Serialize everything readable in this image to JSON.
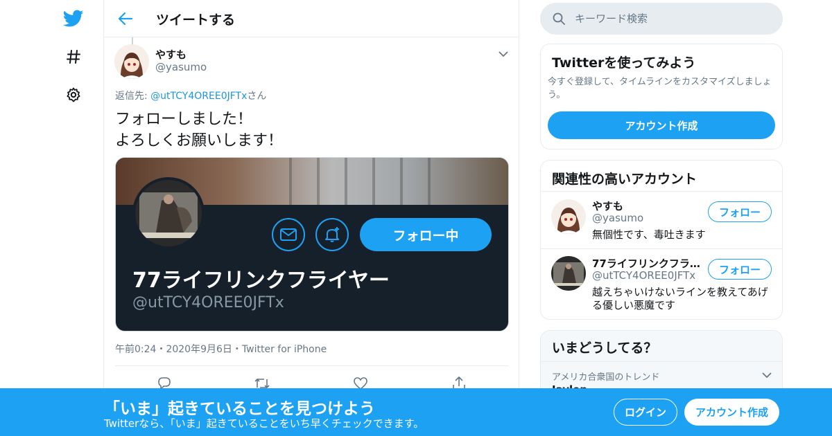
{
  "header": {
    "title": "ツイートする"
  },
  "tweet": {
    "author_name": "やすも",
    "author_handle": "@yasumo",
    "reply_prefix": "返信先: ",
    "reply_to": "@utTCY4OREE0JFTx",
    "reply_suffix": "さん",
    "text": "フォローしました！\nよろしくお願いします！",
    "media": {
      "profile_name": "77ライフリンクフライヤー",
      "profile_handle": "@utTCY4OREE0JFTx",
      "follow_label": "フォロー中"
    },
    "time": "午前0:24",
    "date": "2020年9月6日",
    "source": "Twitter for iPhone",
    "separator": "・"
  },
  "search": {
    "placeholder": "キーワード検索"
  },
  "signup_card": {
    "title": "Twitterを使ってみよう",
    "description": "今すぐ登録して、タイムラインをカスタマイズしましょう。",
    "button": "アカウント作成"
  },
  "related": {
    "title": "関連性の高いアカウント",
    "accounts": [
      {
        "name": "やすも",
        "handle": "@yasumo",
        "bio": "無個性です、毒吐きます",
        "follow": "フォロー"
      },
      {
        "name": "77ライフリンクフライヤー",
        "handle": "@utTCY4OREE0JFTx",
        "bio": "越えちゃいけないラインを教えてあげる優しい悪魔です",
        "follow": "フォロー"
      }
    ]
  },
  "trends": {
    "title": "いまどうしてる？",
    "label": "アメリカ合衆国のトレンド",
    "first": "Jaylen"
  },
  "bottom_bar": {
    "title": "「いま」起きていることを見つけよう",
    "subtitle": "Twitterなら、「いま」起きていることをいち早くチェックできます。",
    "login": "ログイン",
    "signup": "アカウント作成"
  },
  "colors": {
    "accent": "#1da1f2",
    "link": "#1b95e0",
    "muted": "#657786",
    "border": "#e6ecf0"
  },
  "icons": [
    "twitter-logo-icon",
    "hashtag-icon",
    "gear-icon",
    "back-arrow-icon",
    "chevron-down-icon",
    "mail-icon",
    "bell-plus-icon",
    "reply-icon",
    "retweet-icon",
    "like-icon",
    "share-icon",
    "search-icon"
  ]
}
